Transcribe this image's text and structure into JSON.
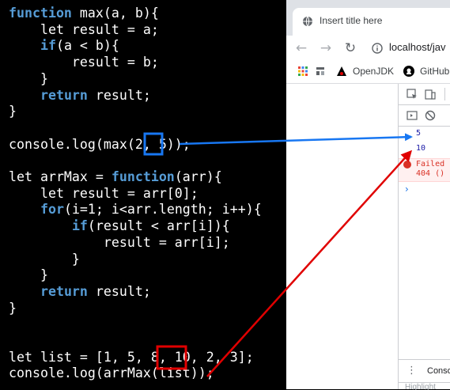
{
  "code": {
    "lines": [
      [
        {
          "t": "function",
          "kw": true
        },
        {
          "t": " max(a, b){"
        }
      ],
      [
        {
          "t": "    let result = a;"
        }
      ],
      [
        {
          "t": "    "
        },
        {
          "t": "if",
          "kw": true
        },
        {
          "t": "(a < b){"
        }
      ],
      [
        {
          "t": "        result = b;"
        }
      ],
      [
        {
          "t": "    }"
        }
      ],
      [
        {
          "t": "    "
        },
        {
          "t": "return",
          "kw": true
        },
        {
          "t": " result;"
        }
      ],
      [
        {
          "t": "}"
        }
      ],
      [
        {
          "t": ""
        }
      ],
      [
        {
          "t": "console.log(max(2, 5));"
        }
      ],
      [
        {
          "t": ""
        }
      ],
      [
        {
          "t": "let arrMax = "
        },
        {
          "t": "function",
          "kw": true
        },
        {
          "t": "(arr){"
        }
      ],
      [
        {
          "t": "    let result = arr[0];"
        }
      ],
      [
        {
          "t": "    "
        },
        {
          "t": "for",
          "kw": true
        },
        {
          "t": "(i=1; i<arr.length; i++){"
        }
      ],
      [
        {
          "t": "        "
        },
        {
          "t": "if",
          "kw": true
        },
        {
          "t": "(result < arr[i]){"
        }
      ],
      [
        {
          "t": "            result = arr[i];"
        }
      ],
      [
        {
          "t": "        }"
        }
      ],
      [
        {
          "t": "    }"
        }
      ],
      [
        {
          "t": "    "
        },
        {
          "t": "return",
          "kw": true
        },
        {
          "t": " result;"
        }
      ],
      [
        {
          "t": "}"
        }
      ],
      [
        {
          "t": ""
        }
      ],
      [
        {
          "t": ""
        }
      ],
      [
        {
          "t": "let list = [1, 5, 8, 10, 2, 3];"
        }
      ],
      [
        {
          "t": "console.log(arrMax(list));"
        }
      ]
    ]
  },
  "colors": {
    "keyword": "#569cd6",
    "highlight_blue": "#1877f2",
    "highlight_red": "#e00000",
    "console_value": "#1a1aa6",
    "error": "#d93025"
  },
  "browser": {
    "tab_title": "Insert title here",
    "tab_icon": "globe-icon",
    "url": "localhost/jav",
    "bookmarks": {
      "openjdk": "OpenJDK",
      "github": "GitHub"
    }
  },
  "devtools": {
    "console_output": {
      "value1": "5",
      "value2": "10",
      "error_line1": "Failed",
      "error_line2": "404 ()",
      "prompt": "›"
    },
    "drawer_tab": "Conso",
    "drawer_below": "Highlight"
  }
}
